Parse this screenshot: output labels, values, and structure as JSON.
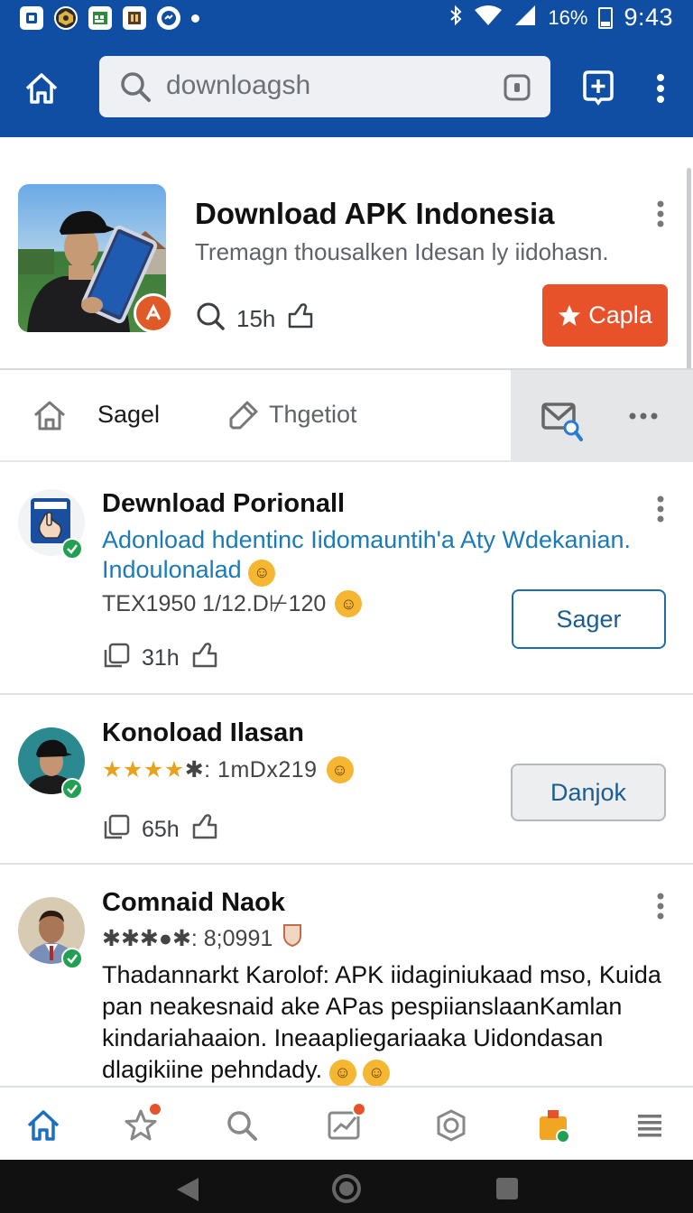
{
  "status_bar": {
    "battery": "16%",
    "time": "9:43",
    "icons": [
      "notification-icon",
      "game-icon",
      "calendar-icon",
      "book-icon",
      "messenger-icon",
      "bluetooth-icon",
      "wifi-icon",
      "signal-icon",
      "battery-icon"
    ]
  },
  "app_bar": {
    "search_value": "downloagsh",
    "icons": [
      "home-icon",
      "search-icon",
      "scan-icon",
      "add-icon",
      "more-vertical-icon"
    ],
    "color": "#0f4ea3"
  },
  "featured": {
    "title": "Download APK Indonesia",
    "subtitle": "Tremagn thousalken Idesan ly iidohasn.",
    "time": "15h",
    "button_label": "Capla",
    "button_color": "#e8522a"
  },
  "tabs": {
    "items": [
      {
        "label": "Sagel",
        "icon": "home-icon"
      },
      {
        "label": "Thgetiot",
        "icon": "tag-icon"
      }
    ],
    "icons": [
      "mail-search-icon",
      "more-horizontal-icon"
    ]
  },
  "list": [
    {
      "title": "Dewnload Porionall",
      "description": "Adonload hdentinc Iidomauntih'a Aty Wdekanian. Indoulonalad",
      "meta_line": "TEX1950 1/12.D⊬120",
      "time": "31h",
      "button_label": "Sager"
    },
    {
      "title": "Konoload Ilasan",
      "meta_line": "★★★★✱: 1mDx219",
      "rating": 4,
      "time": "65h",
      "button_label": "Danjok"
    },
    {
      "title": "Comnaid Naok",
      "meta_line": "✱✱✱●✱: 8;0991",
      "body": "Thadannarkt Karolof: APK iidaginiukaad mso, Kuida pan neakesnaid ake APas pespiianslaanKamlan kindariahaaion. Ineaapliegariaaka Uidondasan dlagikiine pehndady."
    }
  ],
  "bottom_nav": {
    "items": [
      "home-icon",
      "star-icon",
      "search-icon",
      "chart-icon",
      "camera-icon",
      "store-icon",
      "menu-icon"
    ],
    "active": "home-icon"
  }
}
